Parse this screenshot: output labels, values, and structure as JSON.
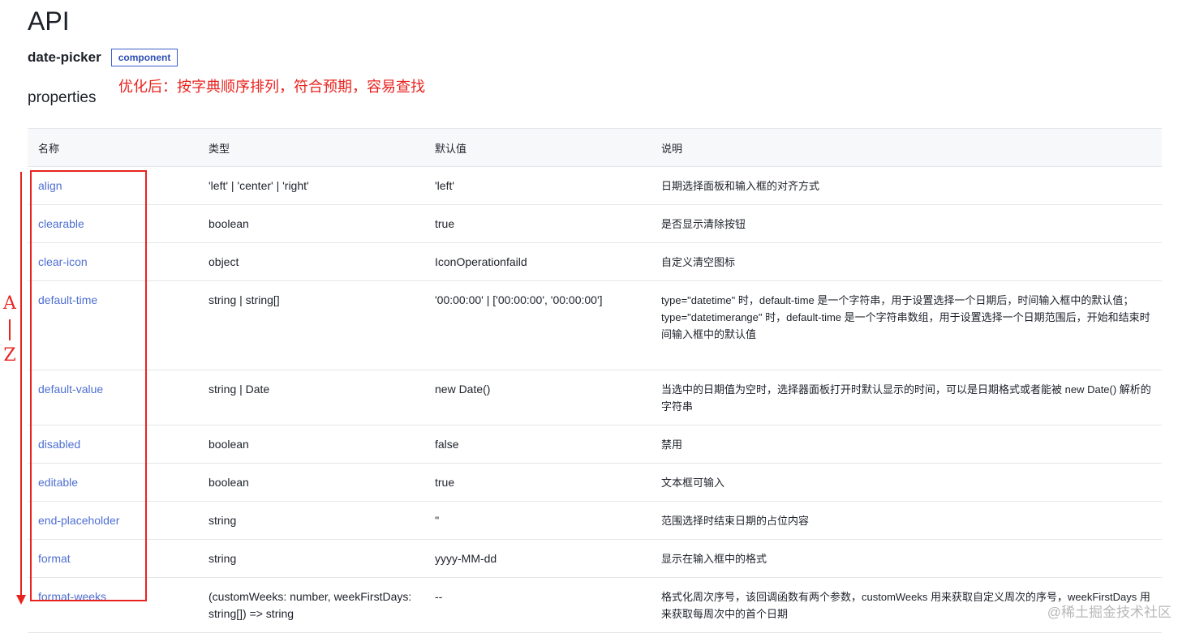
{
  "page": {
    "title": "API",
    "component_name": "date-picker",
    "component_badge": "component",
    "section_title": "properties",
    "annotation": "优化后：按字典顺序排列，符合预期，容易查找",
    "az_top": "A",
    "az_bottom": "Z",
    "watermark": "@稀土掘金技术社区"
  },
  "annotation_color": "#e8231f",
  "link_color": "#4e6fd1",
  "table": {
    "headers": [
      "名称",
      "类型",
      "默认值",
      "说明"
    ],
    "rows": [
      {
        "name": "align",
        "type": "'left' | 'center' | 'right'",
        "default": "'left'",
        "desc": "日期选择面板和输入框的对齐方式"
      },
      {
        "name": "clearable",
        "type": "boolean",
        "default": "true",
        "desc": "是否显示清除按钮"
      },
      {
        "name": "clear-icon",
        "type": "object",
        "default": "IconOperationfaild",
        "desc": "自定义清空图标"
      },
      {
        "name": "default-time",
        "type": "string | string[]",
        "default": "'00:00:00' | ['00:00:00', '00:00:00']",
        "desc": "type=\"datetime\" 时，default-time 是一个字符串，用于设置选择一个日期后，时间输入框中的默认值；\ntype=\"datetimerange\" 时，default-time 是一个字符串数组，用于设置选择一个日期范围后，开始和结束时间输入框中的默认值"
      },
      {
        "name": "default-value",
        "type": "string | Date",
        "default": "new Date()",
        "desc": "当选中的日期值为空时，选择器面板打开时默认显示的时间，可以是日期格式或者能被 new Date() 解析的字符串"
      },
      {
        "name": "disabled",
        "type": "boolean",
        "default": "false",
        "desc": "禁用"
      },
      {
        "name": "editable",
        "type": "boolean",
        "default": "true",
        "desc": "文本框可输入"
      },
      {
        "name": "end-placeholder",
        "type": "string",
        "default": "''",
        "desc": "范围选择时结束日期的占位内容"
      },
      {
        "name": "format",
        "type": "string",
        "default": "yyyy-MM-dd",
        "desc": "显示在输入框中的格式"
      },
      {
        "name": "format-weeks",
        "type": "(customWeeks: number, weekFirstDays: string[]) => string",
        "default": "--",
        "desc": "格式化周次序号，该回调函数有两个参数，customWeeks 用来获取自定义周次的序号，weekFirstDays 用来获取每周次中的首个日期"
      }
    ]
  }
}
